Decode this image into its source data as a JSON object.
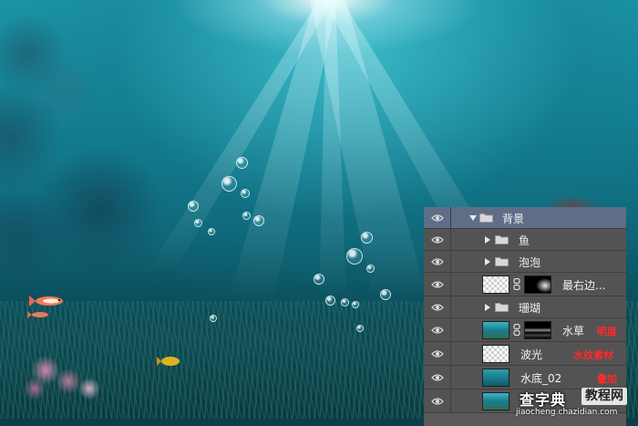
{
  "layers_panel": {
    "layers": [
      {
        "name": "背景",
        "type": "group",
        "expanded": true,
        "selected": true
      },
      {
        "name": "鱼",
        "type": "group",
        "expanded": false
      },
      {
        "name": "泡泡",
        "type": "group",
        "expanded": false
      },
      {
        "name": "最右边...",
        "type": "image-with-mask",
        "thumbnail": "checker",
        "mask": "dark-glow"
      },
      {
        "name": "珊瑚",
        "type": "group",
        "expanded": false
      },
      {
        "name": "水草",
        "type": "image-with-mask",
        "thumbnail": "water",
        "mask": "dark-streaks",
        "note": "明度"
      },
      {
        "name": "波光",
        "type": "image",
        "thumbnail": "checker",
        "note": "水纹素材"
      },
      {
        "name": "水底_02",
        "type": "image",
        "thumbnail": "deep",
        "note": "叠加"
      },
      {
        "name": "",
        "type": "image",
        "thumbnail": "water"
      }
    ],
    "annotation_color": "#ff2a2a",
    "selected_row_color": "#5f6e86",
    "row_color": "#535353"
  },
  "watermark": {
    "title": "查字典",
    "tag": "教程网",
    "url": "jiaocheng.chazidian.com"
  }
}
